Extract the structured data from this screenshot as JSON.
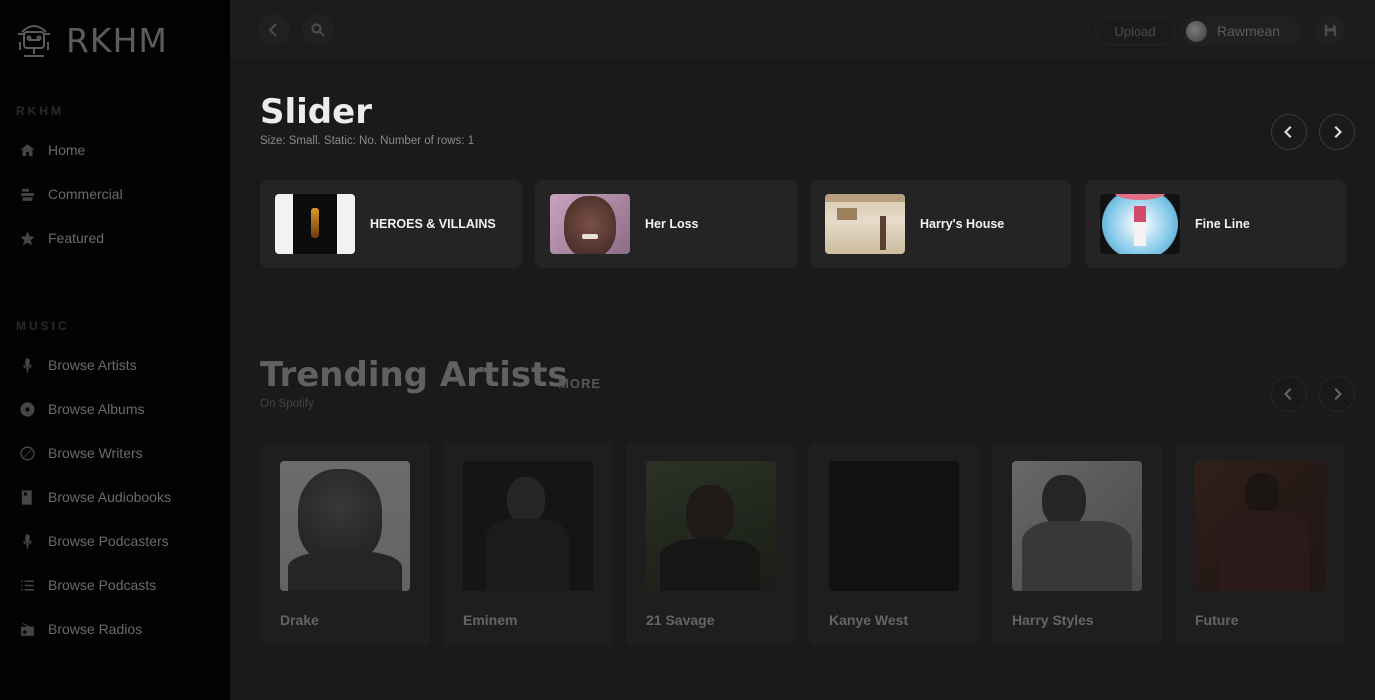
{
  "app": {
    "name": "RKHM"
  },
  "sidebar": {
    "sections": [
      {
        "title": "RKHM",
        "items": [
          {
            "label": "Home",
            "icon": "home-icon"
          },
          {
            "label": "Commercial",
            "icon": "commercial-icon"
          },
          {
            "label": "Featured",
            "icon": "star-icon"
          }
        ]
      },
      {
        "title": "MUSIC",
        "items": [
          {
            "label": "Browse Artists",
            "icon": "microphone-icon"
          },
          {
            "label": "Browse Albums",
            "icon": "disc-icon"
          },
          {
            "label": "Browse Writers",
            "icon": "compass-icon"
          },
          {
            "label": "Browse Audiobooks",
            "icon": "audiobook-icon"
          },
          {
            "label": "Browse Podcasters",
            "icon": "microphone-icon"
          },
          {
            "label": "Browse Podcasts",
            "icon": "list-icon"
          },
          {
            "label": "Browse Radios",
            "icon": "radio-icon"
          }
        ]
      }
    ]
  },
  "topbar": {
    "upload_label": "Upload",
    "user_name": "Rawmean"
  },
  "slider": {
    "title": "Slider",
    "subtitle": "Size: Small. Static: No. Number of rows: 1",
    "items": [
      {
        "title": "HEROES & VILLAINS"
      },
      {
        "title": "Her Loss"
      },
      {
        "title": "Harry's House"
      },
      {
        "title": "Fine Line"
      }
    ]
  },
  "trending": {
    "title": "Trending Artists",
    "more_label": "MORE",
    "subtitle": "On Spotify",
    "artists": [
      {
        "name": "Drake"
      },
      {
        "name": "Eminem"
      },
      {
        "name": "21 Savage"
      },
      {
        "name": "Kanye West"
      },
      {
        "name": "Harry Styles"
      },
      {
        "name": "Future"
      }
    ]
  }
}
